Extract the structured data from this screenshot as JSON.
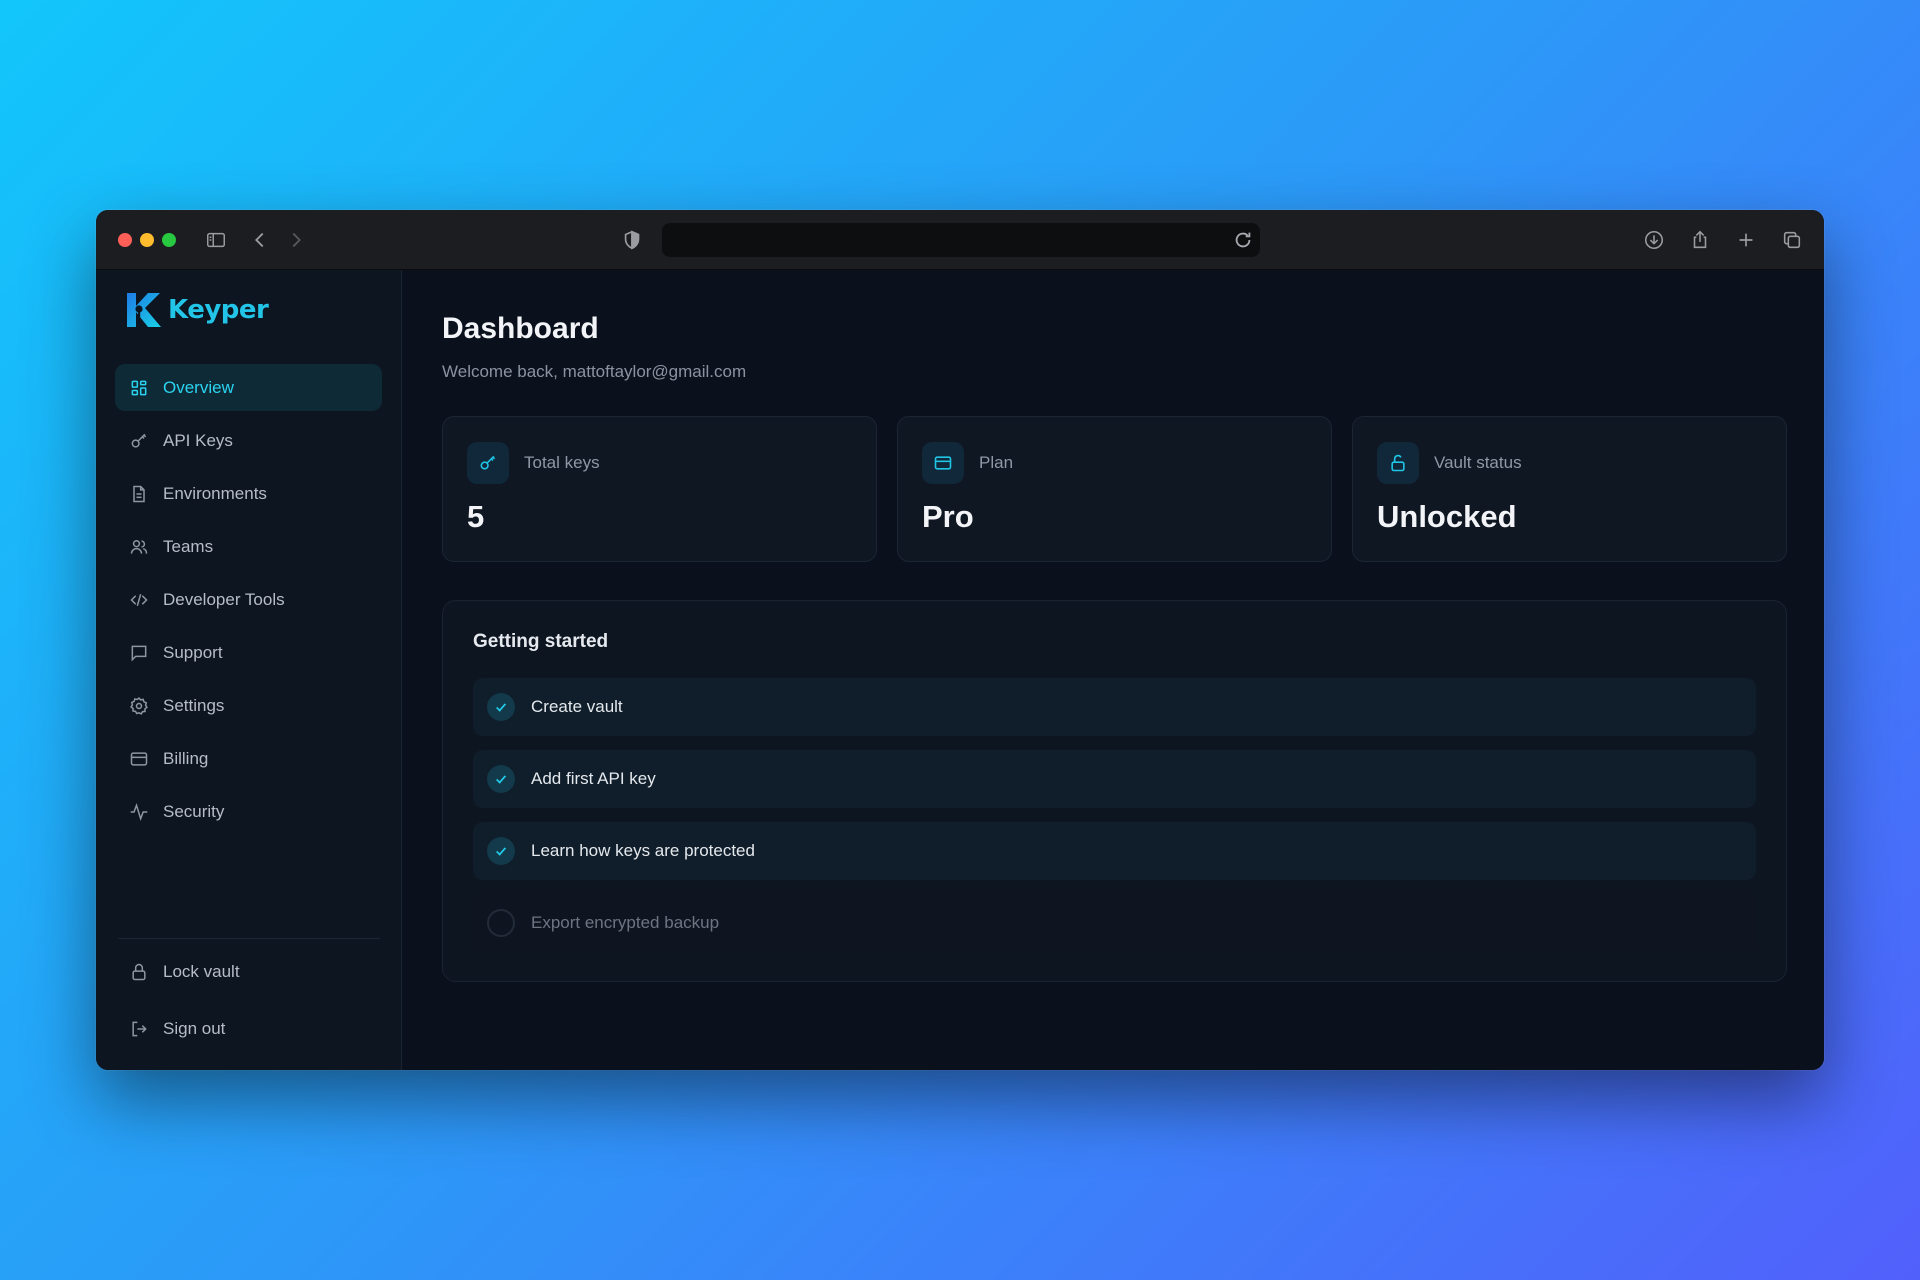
{
  "brand": {
    "name": "Keyper",
    "accent": "#22c5e8"
  },
  "browser": {
    "url": ""
  },
  "sidebar": {
    "items": [
      {
        "label": "Overview",
        "icon": "grid-icon",
        "active": true
      },
      {
        "label": "API Keys",
        "icon": "key-icon"
      },
      {
        "label": "Environments",
        "icon": "file-icon"
      },
      {
        "label": "Teams",
        "icon": "users-icon"
      },
      {
        "label": "Developer Tools",
        "icon": "code-icon"
      },
      {
        "label": "Support",
        "icon": "message-icon"
      },
      {
        "label": "Settings",
        "icon": "gear-icon"
      },
      {
        "label": "Billing",
        "icon": "credit-card-icon"
      },
      {
        "label": "Security",
        "icon": "activity-icon"
      }
    ],
    "footer": [
      {
        "label": "Lock vault",
        "icon": "lock-icon"
      },
      {
        "label": "Sign out",
        "icon": "sign-out-icon"
      }
    ]
  },
  "header": {
    "title": "Dashboard",
    "subtitle": "Welcome back, mattoftaylor@gmail.com"
  },
  "stats": [
    {
      "label": "Total keys",
      "value": "5",
      "icon": "key-icon"
    },
    {
      "label": "Plan",
      "value": "Pro",
      "icon": "credit-card-icon"
    },
    {
      "label": "Vault status",
      "value": "Unlocked",
      "icon": "unlock-icon"
    }
  ],
  "getting_started": {
    "title": "Getting started",
    "steps": [
      {
        "label": "Create vault",
        "done": true
      },
      {
        "label": "Add first API key",
        "done": true
      },
      {
        "label": "Learn how keys are protected",
        "done": true
      },
      {
        "label": "Export encrypted backup",
        "done": false
      }
    ]
  }
}
